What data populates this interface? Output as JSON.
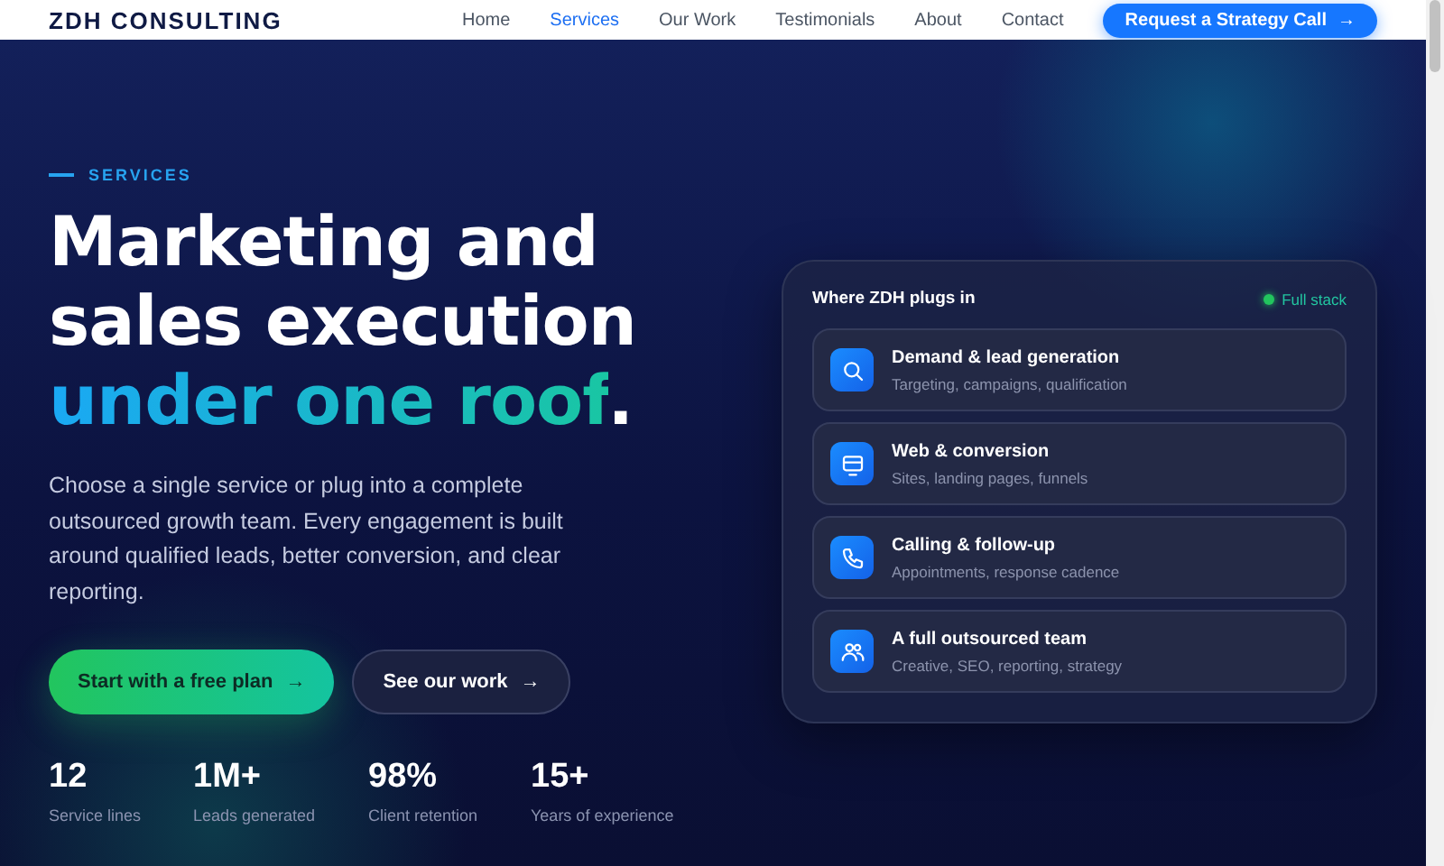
{
  "header": {
    "logo": "ZDH CONSULTING",
    "nav": [
      {
        "label": "Home",
        "selected": false
      },
      {
        "label": "Services",
        "selected": true
      },
      {
        "label": "Our Work",
        "selected": false
      },
      {
        "label": "Testimonials",
        "selected": false
      },
      {
        "label": "About",
        "selected": false
      },
      {
        "label": "Contact",
        "selected": false
      }
    ],
    "cta": "Request a Strategy Call",
    "cta_arrow": "→"
  },
  "hero": {
    "eyebrow": "SERVICES",
    "headline_lines": [
      "Marketing and",
      "sales execution"
    ],
    "headline_accent": "under one roof",
    "headline_end": ".",
    "description": "Choose a single service or plug into a complete outsourced growth team. Every engagement is built around qualified leads, better conversion, and clear reporting.",
    "buttons": [
      {
        "label": "Start with a free plan",
        "arrow": "→",
        "kind": "primary"
      },
      {
        "label": "See our work",
        "arrow": "→",
        "kind": "secondary"
      }
    ],
    "stats": [
      {
        "value": "12",
        "label": "Service lines"
      },
      {
        "value": "1M+",
        "label": "Leads generated"
      },
      {
        "value": "98%",
        "label": "Client retention"
      },
      {
        "value": "15+",
        "label": "Years of experience"
      }
    ]
  },
  "panel": {
    "title": "Where ZDH plugs in",
    "status": {
      "label": "Full stack",
      "color": "#22c55e"
    },
    "items": [
      {
        "kind": "search",
        "title": "Demand & lead generation",
        "subtitle": "Targeting, campaigns, qualification"
      },
      {
        "kind": "web",
        "title": "Web & conversion",
        "subtitle": "Sites, landing pages, funnels"
      },
      {
        "kind": "phone",
        "title": "Calling & follow-up",
        "subtitle": "Appointments, response cadence"
      },
      {
        "kind": "team",
        "title": "A full outsourced team",
        "subtitle": "Creative, SEO, reporting, strategy"
      }
    ]
  }
}
